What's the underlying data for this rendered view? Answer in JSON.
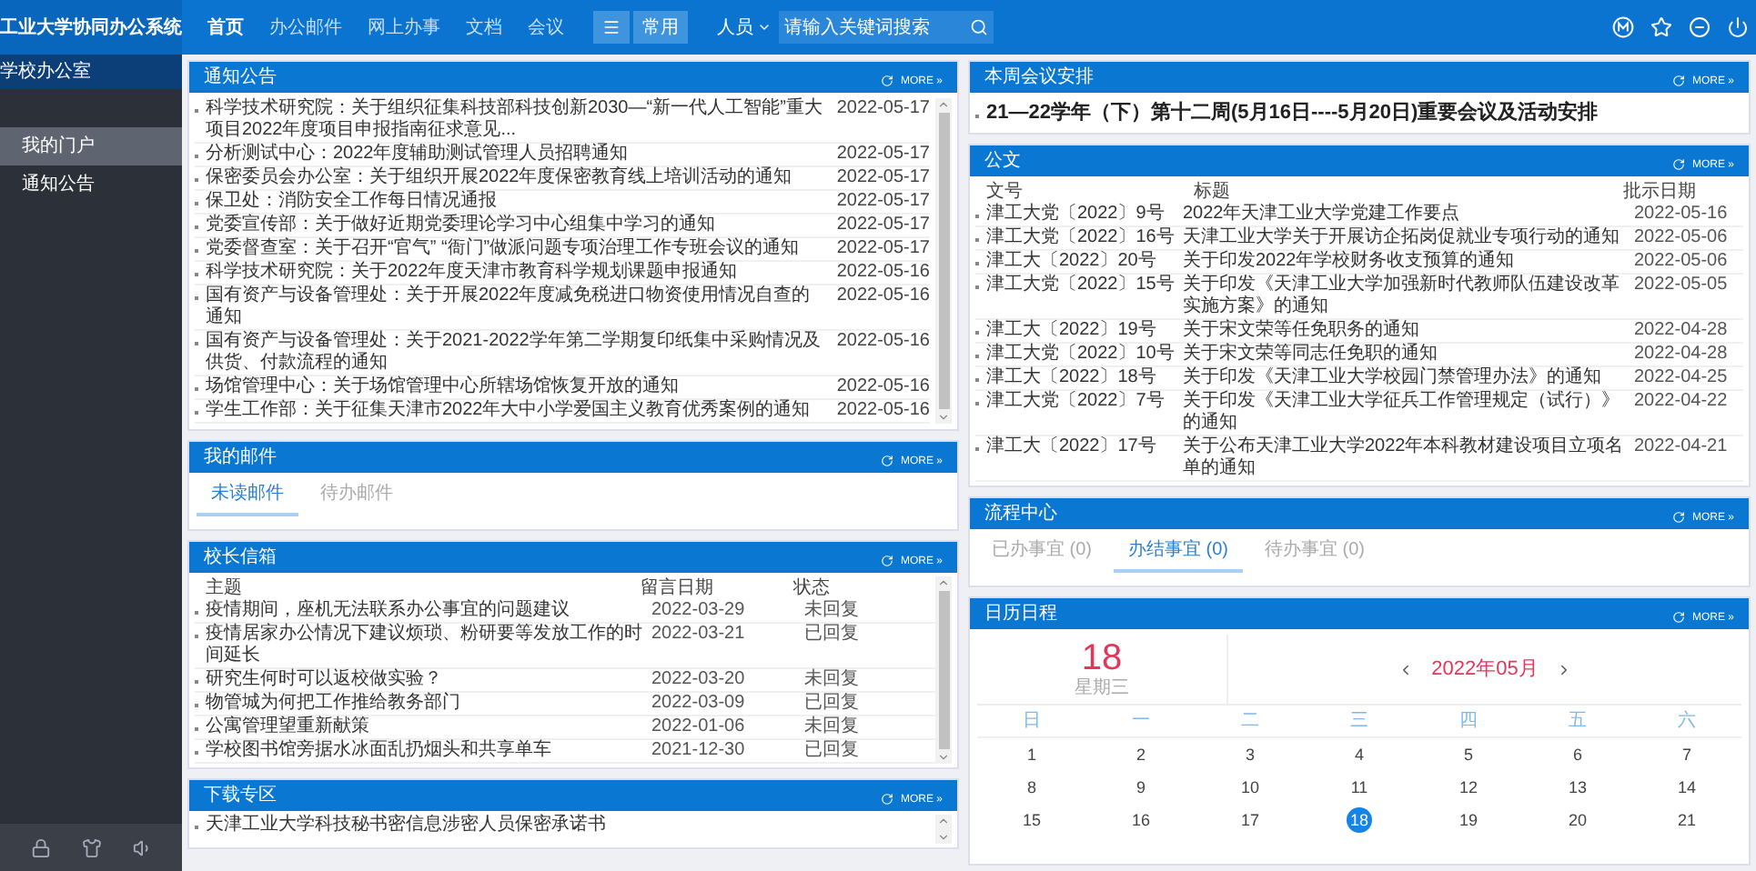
{
  "header": {
    "title": "工业大学协同办公系统",
    "nav": [
      {
        "label": "首页",
        "selected": true
      },
      {
        "label": "办公邮件",
        "selected": false
      },
      {
        "label": "网上办事",
        "selected": false
      },
      {
        "label": "文档",
        "selected": false
      },
      {
        "label": "会议",
        "selected": false
      }
    ],
    "quick": "常用",
    "search": {
      "scope": "人员",
      "placeholder": "请输入关键词搜索"
    }
  },
  "sidebar": {
    "title": "学校办公室",
    "items": [
      {
        "label": "我的门户",
        "selected": true
      },
      {
        "label": "通知公告",
        "selected": false
      }
    ]
  },
  "notices": {
    "title": "通知公告",
    "more": "MORE »",
    "rows": [
      {
        "title": "科学技术研究院：关于组织征集科技部科技创新2030—“新一代人工智能”重大项目2022年度项目申报指南征求意见...",
        "date": "2022-05-17"
      },
      {
        "title": "分析测试中心：2022年度辅助测试管理人员招聘通知",
        "date": "2022-05-17"
      },
      {
        "title": "保密委员会办公室：关于组织开展2022年度保密教育线上培训活动的通知",
        "date": "2022-05-17"
      },
      {
        "title": "保卫处：消防安全工作每日情况通报",
        "date": "2022-05-17"
      },
      {
        "title": "党委宣传部：关于做好近期党委理论学习中心组集中学习的通知",
        "date": "2022-05-17"
      },
      {
        "title": "党委督查室：关于召开“官气” “衙门”做派问题专项治理工作专班会议的通知",
        "date": "2022-05-17"
      },
      {
        "title": "科学技术研究院：关于2022年度天津市教育科学规划课题申报通知",
        "date": "2022-05-16"
      },
      {
        "title": "国有资产与设备管理处：关于开展2022年度减免税进口物资使用情况自查的通知",
        "date": "2022-05-16"
      },
      {
        "title": "国有资产与设备管理处：关于2021-2022学年第二学期复印纸集中采购情况及供货、付款流程的通知",
        "date": "2022-05-16"
      },
      {
        "title": "场馆管理中心：关于场馆管理中心所辖场馆恢复开放的通知",
        "date": "2022-05-16"
      },
      {
        "title": "学生工作部：关于征集天津市2022年大中小学爱国主义教育优秀案例的通知",
        "date": "2022-05-16"
      }
    ]
  },
  "mail": {
    "title": "我的邮件",
    "more": "MORE »",
    "tabs": [
      {
        "label": "未读邮件",
        "selected": true
      },
      {
        "label": "待办邮件",
        "selected": false
      }
    ]
  },
  "mailbox": {
    "title": "校长信箱",
    "more": "MORE »",
    "columns": [
      "主题",
      "留言日期",
      "状态"
    ],
    "rows": [
      {
        "subject": "疫情期间，座机无法联系办公事宜的问题建议",
        "date": "2022-03-29",
        "status": "未回复"
      },
      {
        "subject": "疫情居家办公情况下建议烦琐、粉研要等发放工作的时间延长",
        "date": "2022-03-21",
        "status": "已回复"
      },
      {
        "subject": "研究生何时可以返校做实验？",
        "date": "2022-03-20",
        "status": "未回复"
      },
      {
        "subject": "物管城为何把工作推给教务部门",
        "date": "2022-03-09",
        "status": "已回复"
      },
      {
        "subject": "公寓管理望重新献策",
        "date": "2022-01-06",
        "status": "未回复"
      },
      {
        "subject": "学校图书馆旁据水冰面乱扔烟头和共享单车",
        "date": "2021-12-30",
        "status": "已回复"
      }
    ]
  },
  "downloads": {
    "title": "下载专区",
    "more": "MORE »",
    "rows": [
      "天津工业大学科技秘书密信息涉密人员保密承诺书"
    ]
  },
  "meetings": {
    "title": "本周会议安排",
    "more": "MORE »",
    "rows": [
      "21—22学年（下）第十二周(5月16日----5月20日)重要会议及活动安排"
    ]
  },
  "documents": {
    "title": "公文",
    "more": "MORE »",
    "columns": [
      "文号",
      "标题",
      "批示日期"
    ],
    "rows": [
      {
        "number": "津工大党〔2022〕9号",
        "title": "2022年天津工业大学党建工作要点",
        "date": "2022-05-16"
      },
      {
        "number": "津工大党〔2022〕16号",
        "title": "天津工业大学关于开展访企拓岗促就业专项行动的通知",
        "date": "2022-05-06"
      },
      {
        "number": "津工大〔2022〕20号",
        "title": "关于印发2022年学校财务收支预算的通知",
        "date": "2022-05-06"
      },
      {
        "number": "津工大党〔2022〕15号",
        "title": "关于印发《天津工业大学加强新时代教师队伍建设改革实施方案》的通知",
        "date": "2022-05-05"
      },
      {
        "number": "津工大〔2022〕19号",
        "title": "关于宋文荣等任免职务的通知",
        "date": "2022-04-28"
      },
      {
        "number": "津工大党〔2022〕10号",
        "title": "关于宋文荣等同志任免职的通知",
        "date": "2022-04-28"
      },
      {
        "number": "津工大〔2022〕18号",
        "title": "关于印发《天津工业大学校园门禁管理办法》的通知",
        "date": "2022-04-25"
      },
      {
        "number": "津工大党〔2022〕7号",
        "title": "关于印发《天津工业大学征兵工作管理规定（试行）》的通知",
        "date": "2022-04-22"
      },
      {
        "number": "津工大〔2022〕17号",
        "title": "关于公布天津工业大学2022年本科教材建设项目立项名单的通知",
        "date": "2022-04-21"
      }
    ]
  },
  "workflow": {
    "title": "流程中心",
    "more": "MORE »",
    "tabs": [
      {
        "label": "已办事宜 (0)",
        "selected": false
      },
      {
        "label": "办结事宜 (0)",
        "selected": true
      },
      {
        "label": "待办事宜 (0)",
        "selected": false
      }
    ]
  },
  "calendar": {
    "title": "日历日程",
    "more": "MORE »",
    "today": "18",
    "weekday": "星期三",
    "month": "2022年05月",
    "weekdays": [
      "日",
      "一",
      "二",
      "三",
      "四",
      "五",
      "六"
    ],
    "weeks": [
      [
        {
          "day": "1",
          "selected": false
        },
        {
          "day": "2",
          "selected": false
        },
        {
          "day": "3",
          "selected": false
        },
        {
          "day": "4",
          "selected": false
        },
        {
          "day": "5",
          "selected": false
        },
        {
          "day": "6",
          "selected": false
        },
        {
          "day": "7",
          "selected": false
        }
      ],
      [
        {
          "day": "8",
          "selected": false
        },
        {
          "day": "9",
          "selected": false
        },
        {
          "day": "10",
          "selected": false
        },
        {
          "day": "11",
          "selected": false
        },
        {
          "day": "12",
          "selected": false
        },
        {
          "day": "13",
          "selected": false
        },
        {
          "day": "14",
          "selected": false
        }
      ],
      [
        {
          "day": "15",
          "selected": false
        },
        {
          "day": "16",
          "selected": false
        },
        {
          "day": "17",
          "selected": false
        },
        {
          "day": "18",
          "selected": true
        },
        {
          "day": "19",
          "selected": false
        },
        {
          "day": "20",
          "selected": false
        },
        {
          "day": "21",
          "selected": false
        }
      ]
    ]
  }
}
